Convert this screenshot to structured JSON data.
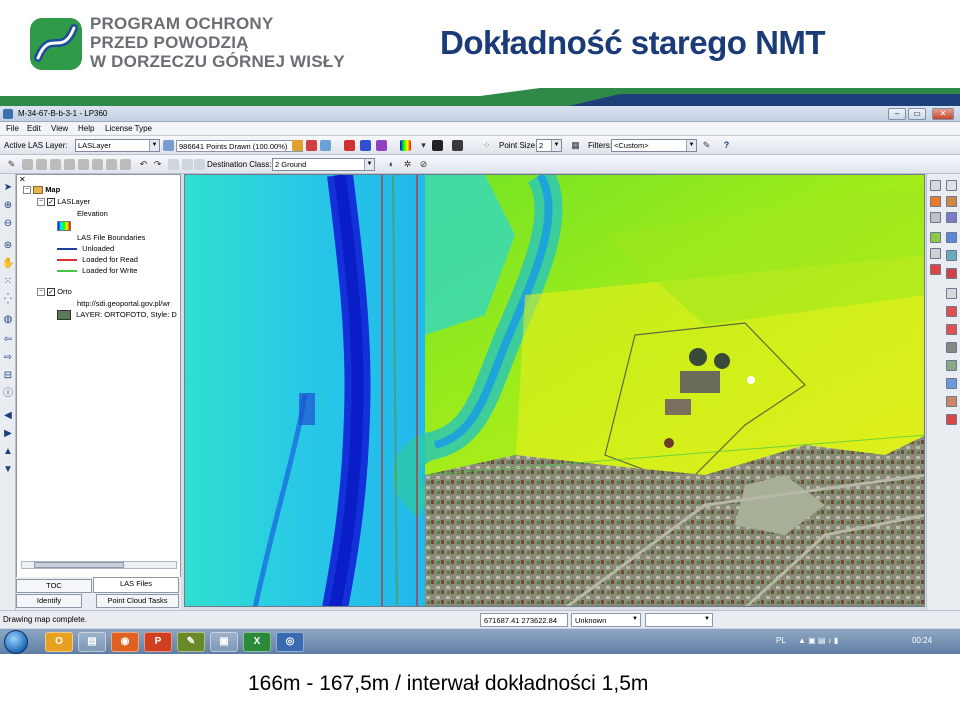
{
  "header": {
    "logo_lines": [
      "PROGRAM OCHRONY",
      "PRZED POWODZIĄ",
      "W DORZECZU GÓRNEJ WISŁY"
    ],
    "title": "Dokładność starego NMT"
  },
  "window": {
    "title": "M-34-67-B-b-3-1 - LP360",
    "controls": [
      "–",
      "▭",
      "✕"
    ]
  },
  "menu": [
    "File",
    "Edit",
    "View",
    "Help",
    "License Type"
  ],
  "toolbar1": {
    "active_layer_label": "Active LAS Layer:",
    "active_layer_value": "LASLayer",
    "points_drawn": "986641 Points Drawn (100.00%)",
    "point_size_label": "Point Size",
    "point_size_value": "2",
    "filters_label": "Filters:",
    "filters_value": "<Custom>"
  },
  "toolbar2": {
    "destination_class_label": "Destination Class:",
    "destination_class_value": "2   Ground"
  },
  "toc": {
    "close": "✕",
    "map_label": "Map",
    "las_layer": "LASLayer",
    "elevation": "Elevation",
    "boundaries": "LAS File Boundaries",
    "legend": [
      {
        "label": "Unloaded",
        "color": "#1f3f9f"
      },
      {
        "label": "Loaded for Read",
        "color": "#d93030"
      },
      {
        "label": "Loaded for Write",
        "color": "#43c843"
      }
    ],
    "orto": "Orto",
    "orto_url": "http://sdi.geoportal.gov.pl/wr",
    "orto_layer": "LAYER: ORTOFOTO, Style: D",
    "tabs": [
      "TOC",
      "LAS Files",
      "Identify",
      "Point Cloud Tasks"
    ]
  },
  "status": {
    "message": "Drawing map complete.",
    "coords": "671687.41 273622.84",
    "unit": "Unknown"
  },
  "taskbar": {
    "apps": [
      "O",
      "▤",
      "◉",
      "P",
      "✎",
      "▣",
      "X",
      "◎"
    ],
    "lang": "PL",
    "time": "00:24"
  },
  "caption": "166m - 167,5m / interwał dokładności 1,5m",
  "colors": {
    "title": "#1a3a78",
    "logo_text": "#6b6f73",
    "river": "#1430d8",
    "elev_low": "#20c8e8",
    "elev_mid": "#7ce81c",
    "elev_high": "#f0f020"
  }
}
